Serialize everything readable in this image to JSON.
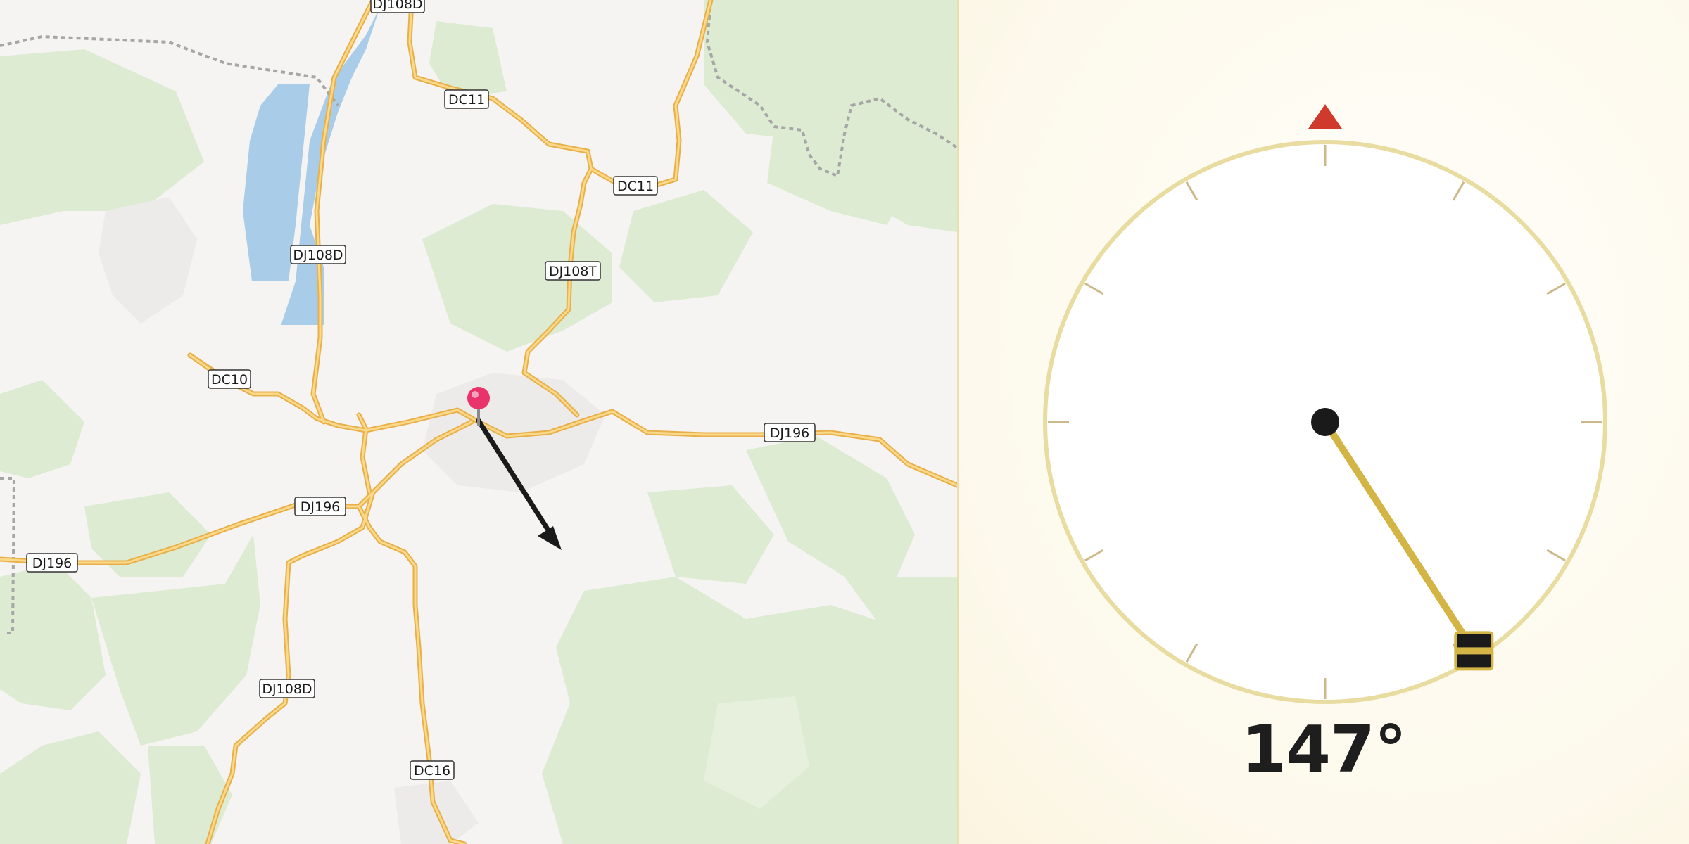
{
  "map": {
    "road_labels": [
      {
        "id": "dj108d-top",
        "text": "DJ108D"
      },
      {
        "id": "dc11-a",
        "text": "DC11"
      },
      {
        "id": "dc11-b",
        "text": "DC11"
      },
      {
        "id": "dj108d-lake",
        "text": "DJ108D"
      },
      {
        "id": "dj108t",
        "text": "DJ108T"
      },
      {
        "id": "dc10",
        "text": "DC10"
      },
      {
        "id": "dj196-east",
        "text": "DJ196"
      },
      {
        "id": "dj196-center",
        "text": "DJ196"
      },
      {
        "id": "dj196-west",
        "text": "DJ196"
      },
      {
        "id": "dj108d-south",
        "text": "DJ108D"
      },
      {
        "id": "dc16",
        "text": "DC16"
      }
    ],
    "marker_icon": "map-pin-icon",
    "direction_arrow_icon": "direction-arrow-icon",
    "colors": {
      "water": "#a9cde9",
      "forest": "#dcebd2",
      "road": "#f5c86a",
      "road_casing": "#e8b04a",
      "pin": "#e8336b",
      "border": "#a6a6a6"
    }
  },
  "compass": {
    "heading_degrees": 147,
    "heading_text": "147°",
    "north_marker_icon": "north-triangle-icon",
    "needle_handle_icon": "needle-handle-icon",
    "colors": {
      "ring": "#e8dca0",
      "needle": "#d4b444",
      "north": "#d03a2c",
      "hub": "#1a1a1a"
    }
  }
}
